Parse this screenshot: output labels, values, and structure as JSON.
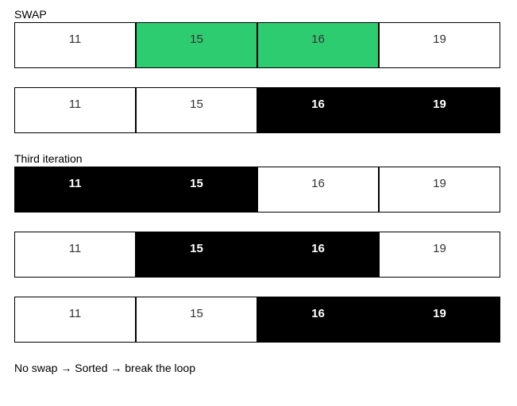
{
  "labels": {
    "swap": "SWAP",
    "third_iteration": "Third iteration",
    "footer": "No swap → Sorted → break the loop"
  },
  "rows": [
    {
      "cells": [
        {
          "value": "11",
          "style": "white"
        },
        {
          "value": "15",
          "style": "green"
        },
        {
          "value": "16",
          "style": "green"
        },
        {
          "value": "19",
          "style": "white"
        }
      ]
    },
    {
      "cells": [
        {
          "value": "11",
          "style": "white"
        },
        {
          "value": "15",
          "style": "white"
        },
        {
          "value": "16",
          "style": "black"
        },
        {
          "value": "19",
          "style": "black"
        }
      ]
    },
    {
      "cells": [
        {
          "value": "11",
          "style": "black"
        },
        {
          "value": "15",
          "style": "black"
        },
        {
          "value": "16",
          "style": "white"
        },
        {
          "value": "19",
          "style": "white"
        }
      ]
    },
    {
      "cells": [
        {
          "value": "11",
          "style": "white"
        },
        {
          "value": "15",
          "style": "black"
        },
        {
          "value": "16",
          "style": "black"
        },
        {
          "value": "19",
          "style": "white"
        }
      ]
    },
    {
      "cells": [
        {
          "value": "11",
          "style": "white"
        },
        {
          "value": "15",
          "style": "white"
        },
        {
          "value": "16",
          "style": "black"
        },
        {
          "value": "19",
          "style": "black"
        }
      ]
    }
  ],
  "colors": {
    "green": "#2ecc71",
    "black": "#000000",
    "white": "#ffffff"
  }
}
